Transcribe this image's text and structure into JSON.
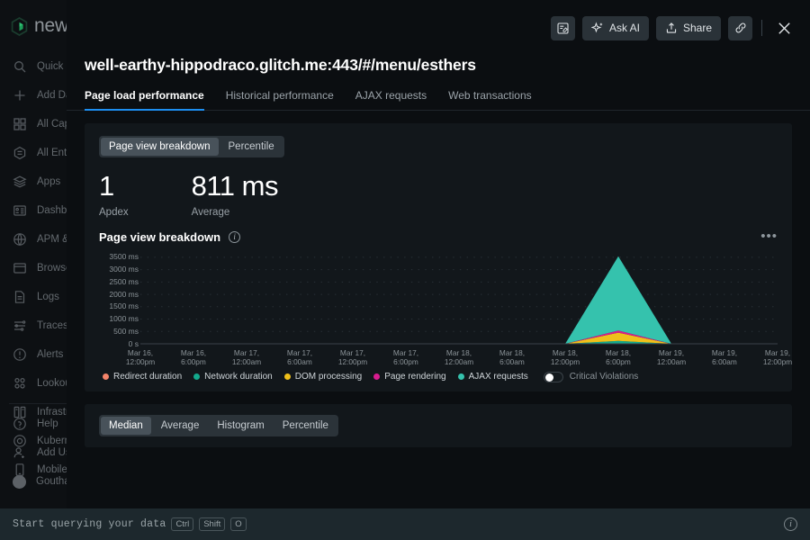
{
  "sidebar": {
    "logo_text": "new",
    "logo_icon": "new-relic-cube-icon",
    "items": [
      {
        "label": "Quick Fi",
        "icon": "search-icon"
      },
      {
        "label": "Add Dat",
        "icon": "plus-icon"
      },
      {
        "label": "All Capa",
        "icon": "grid-icon"
      },
      {
        "label": "All Entiti",
        "icon": "hexagon-list-icon"
      },
      {
        "label": "Apps",
        "icon": "layers-icon"
      },
      {
        "label": "Dashboa",
        "icon": "dashboard-icon"
      },
      {
        "label": "APM & S",
        "icon": "globe-icon"
      },
      {
        "label": "Browser",
        "icon": "browser-window-icon"
      },
      {
        "label": "Logs",
        "icon": "document-icon"
      },
      {
        "label": "Traces",
        "icon": "traces-icon"
      },
      {
        "label": "Alerts &",
        "icon": "alert-circle-icon"
      },
      {
        "label": "Lookout",
        "icon": "lookout-dots-icon"
      },
      {
        "label": "Infrastru",
        "icon": "infrastructure-icon"
      },
      {
        "label": "Kuberne",
        "icon": "kubernetes-target-icon"
      },
      {
        "label": "Mobile",
        "icon": "mobile-device-icon"
      }
    ],
    "bottom_items": [
      {
        "label": "Help",
        "icon": "help-circle-icon"
      },
      {
        "label": "Add Use",
        "icon": "add-user-icon"
      },
      {
        "label": "Gouthar",
        "icon": "user-avatar-icon"
      }
    ]
  },
  "modal": {
    "title": "well-earthy-hippodraco.glitch.me:443/#/menu/esthers",
    "actions": {
      "annotate_icon": "note-edit-icon",
      "ask_ai_label": "Ask AI",
      "ask_ai_icon": "sparkle-icon",
      "share_label": "Share",
      "share_icon": "share-upload-icon",
      "link_icon": "link-icon",
      "close_icon": "close-icon"
    },
    "tabs": [
      {
        "label": "Page load performance",
        "active": true
      },
      {
        "label": "Historical performance",
        "active": false
      },
      {
        "label": "AJAX requests",
        "active": false
      },
      {
        "label": "Web transactions",
        "active": false
      }
    ]
  },
  "panel": {
    "view_segments": [
      {
        "label": "Page view breakdown",
        "active": true
      },
      {
        "label": "Percentile",
        "active": false
      }
    ],
    "metrics": [
      {
        "value": "1",
        "label": "Apdex"
      },
      {
        "value": "811 ms",
        "label": "Average"
      }
    ],
    "section_title": "Page view breakdown",
    "info_icon": "info-icon",
    "overflow_icon": "more-options-icon",
    "critical_violations_label": "Critical Violations",
    "bottom_segments": [
      {
        "label": "Median",
        "active": true
      },
      {
        "label": "Average",
        "active": false
      },
      {
        "label": "Histogram",
        "active": false
      },
      {
        "label": "Percentile",
        "active": false
      }
    ]
  },
  "chart_data": {
    "type": "area",
    "stacked": true,
    "title": "Page view breakdown",
    "xlabel": "",
    "ylabel": "",
    "ylim": [
      0,
      3750
    ],
    "yticks": [
      0,
      500,
      1000,
      1500,
      2000,
      2500,
      3000,
      3500
    ],
    "ytick_labels": [
      "0 s",
      "500 ms",
      "1000 ms",
      "1500 ms",
      "2000 ms",
      "2500 ms",
      "3000 ms",
      "3500 ms"
    ],
    "grid": true,
    "legend_position": "bottom",
    "xtick_labels": [
      "Mar 16,\n12:00pm",
      "Mar 16,\n6:00pm",
      "Mar 17,\n12:00am",
      "Mar 17,\n6:00am",
      "Mar 17,\n12:00pm",
      "Mar 17,\n6:00pm",
      "Mar 18,\n12:00am",
      "Mar 18,\n6:00am",
      "Mar 18,\n12:00pm",
      "Mar 18,\n6:00pm",
      "Mar 19,\n12:00am",
      "Mar 19,\n6:00am",
      "Mar 19,\n12:00pm"
    ],
    "x": [
      0,
      1,
      2,
      3,
      4,
      5,
      6,
      7,
      8,
      9,
      10,
      11,
      12
    ],
    "series": [
      {
        "name": "Redirect duration",
        "color": "#f4846a",
        "values": [
          0,
          0,
          0,
          0,
          0,
          0,
          0,
          0,
          0,
          0,
          0,
          0,
          0
        ]
      },
      {
        "name": "Network duration",
        "color": "#13a98c",
        "values": [
          0,
          0,
          0,
          0,
          0,
          0,
          0,
          0,
          0,
          120,
          0,
          0,
          0
        ]
      },
      {
        "name": "DOM processing",
        "color": "#efc01a",
        "values": [
          0,
          0,
          0,
          0,
          0,
          0,
          0,
          0,
          0,
          330,
          0,
          0,
          0
        ]
      },
      {
        "name": "Page rendering",
        "color": "#d81c8f",
        "values": [
          0,
          0,
          0,
          0,
          0,
          0,
          0,
          0,
          0,
          90,
          0,
          0,
          0
        ]
      },
      {
        "name": "AJAX requests",
        "color": "#35c2ad",
        "values": [
          0,
          0,
          0,
          0,
          0,
          0,
          0,
          0,
          0,
          3000,
          0,
          0,
          0
        ]
      }
    ],
    "spike_peak_total_ms": 3540,
    "spike_x_label": "Mar 18, 6:00pm"
  },
  "querybar": {
    "text": "Start querying your data",
    "keys": [
      "Ctrl",
      "Shift",
      "O"
    ],
    "info_icon": "info-icon"
  }
}
